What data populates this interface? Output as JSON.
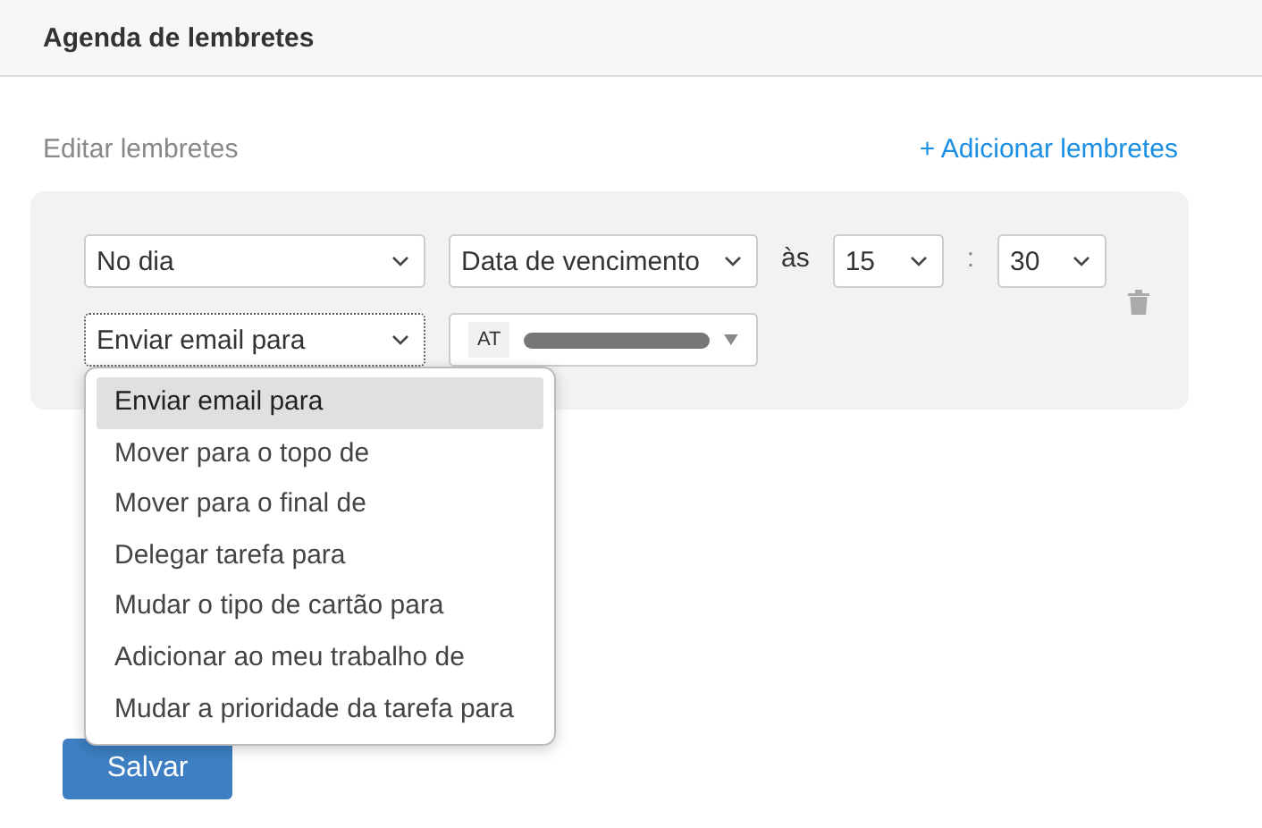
{
  "header": {
    "title": "Agenda de lembretes"
  },
  "section": {
    "title": "Editar lembretes",
    "add_link": "+ Adicionar lembretes"
  },
  "reminder": {
    "when": "No dia",
    "reference": "Data de vencimento",
    "at_label": "às",
    "hour": "15",
    "separator": ":",
    "minute": "30",
    "action": "Enviar email para",
    "assignee_initials": "AT"
  },
  "action_menu": {
    "options": [
      {
        "label": "Enviar email para",
        "selected": true
      },
      {
        "label": "Mover para o topo de",
        "selected": false
      },
      {
        "label": "Mover para o final de",
        "selected": false
      },
      {
        "label": "Delegar tarefa para",
        "selected": false
      },
      {
        "label": "Mudar o tipo de cartão para",
        "selected": false
      },
      {
        "label": "Adicionar ao meu trabalho de",
        "selected": false
      },
      {
        "label": "Mudar a prioridade da tarefa para",
        "selected": false
      }
    ]
  },
  "save_button": "Salvar"
}
